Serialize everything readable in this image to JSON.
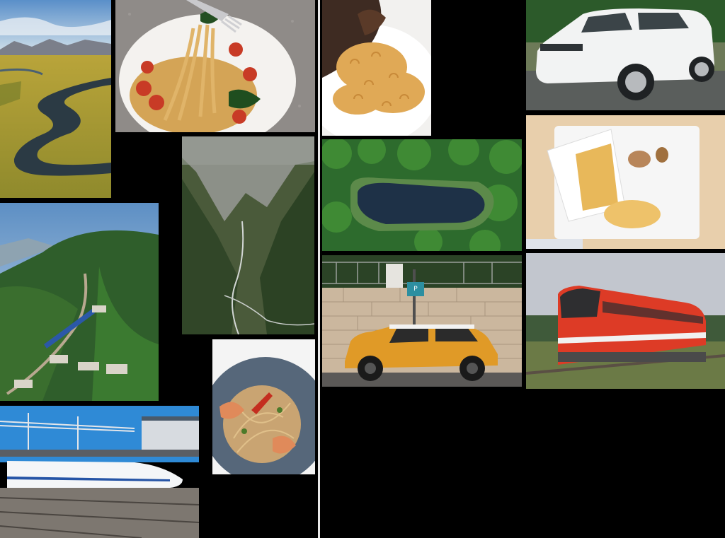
{
  "collage": {
    "background": "#000000",
    "divider_color": "#e8e8e8",
    "tiles": [
      {
        "id": "valley",
        "subject": "valley-river-meadow-photo"
      },
      {
        "id": "spaghetti",
        "subject": "spaghetti-fork-tomato-photo"
      },
      {
        "id": "macaroni",
        "subject": "macaroni-plate-photo"
      },
      {
        "id": "white-suv",
        "subject": "white-suv-photo"
      },
      {
        "id": "mountain-gorge",
        "subject": "green-mountain-gorge-photo"
      },
      {
        "id": "aerial-pond",
        "subject": "aerial-forest-pond-photo"
      },
      {
        "id": "pasta-scoop",
        "subject": "pasta-scoop-tray-photo"
      },
      {
        "id": "hill-train",
        "subject": "blue-train-hill-village-photo"
      },
      {
        "id": "yellow-car",
        "subject": "yellow-mini-car-wall-photo"
      },
      {
        "id": "red-train",
        "subject": "red-regional-train-photo"
      },
      {
        "id": "shrimp-pasta",
        "subject": "shrimp-pasta-plate-photo"
      },
      {
        "id": "bullet-train",
        "subject": "bullet-train-station-photo"
      }
    ],
    "parking_sign_text": "P"
  }
}
